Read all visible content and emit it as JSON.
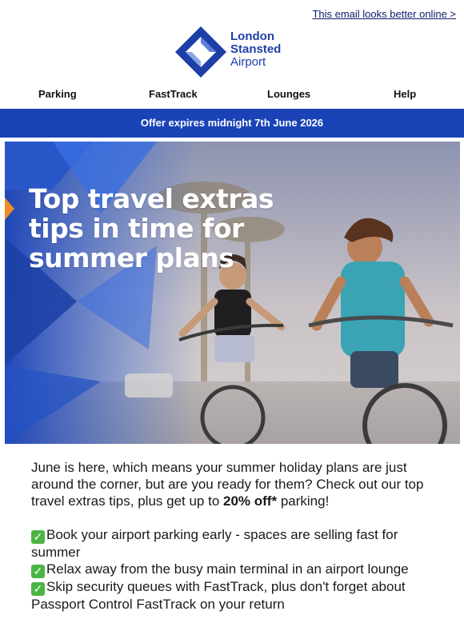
{
  "header": {
    "view_online_link": "This email looks better online >",
    "logo": {
      "line1": "London",
      "line2": "Stansted",
      "line3": "Airport"
    }
  },
  "nav": {
    "items": [
      "Parking",
      "FastTrack",
      "Lounges",
      "Help"
    ]
  },
  "offer_banner": "Offer expires midnight 7th June 2026",
  "hero": {
    "title_line1": "Top travel extras",
    "title_line2": "tips in time for",
    "title_line3": "summer plans"
  },
  "body": {
    "intro_before_bold": "June is here, which means your summer holiday plans are just around the corner, but are you ready for them? Check out our top travel extras tips, plus get up to ",
    "intro_bold": "20% off*",
    "intro_after_bold": " parking!",
    "bullets": [
      "Book your airport parking early - spaces are selling fast for summer",
      "Relax away from the busy main terminal in an airport lounge",
      "Skip security queues with FastTrack, plus don't forget about Passport Control FastTrack on your return"
    ],
    "bullet_icon": "check-mark-icon"
  },
  "colors": {
    "brand_blue": "#1a43b8",
    "link_navy": "#0b1b6b",
    "check_green": "#4bb543"
  }
}
